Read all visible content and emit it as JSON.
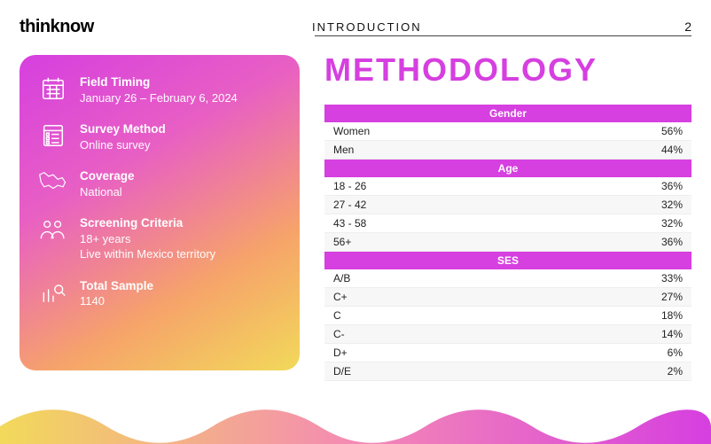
{
  "header": {
    "brand": "thinknow",
    "title": "INTRODUCTION",
    "page": "2"
  },
  "card": {
    "field_timing": {
      "title": "Field Timing",
      "sub": "January 26 – February 6, 2024"
    },
    "survey_method": {
      "title": "Survey Method",
      "sub": "Online survey"
    },
    "coverage": {
      "title": "Coverage",
      "sub": "National"
    },
    "screening": {
      "title": "Screening Criteria",
      "sub1": "18+ years",
      "sub2": "Live within Mexico territory"
    },
    "total_sample": {
      "title": "Total Sample",
      "sub": "1140"
    }
  },
  "main": {
    "title": "METHODOLOGY",
    "sections": {
      "gender": {
        "label": "Gender",
        "rows": [
          {
            "label": "Women",
            "value": "56%"
          },
          {
            "label": "Men",
            "value": "44%"
          }
        ]
      },
      "age": {
        "label": "Age",
        "rows": [
          {
            "label": "18 - 26",
            "value": "36%"
          },
          {
            "label": "27 - 42",
            "value": "32%"
          },
          {
            "label": "43 - 58",
            "value": "32%"
          },
          {
            "label": "56+",
            "value": "36%"
          }
        ]
      },
      "ses": {
        "label": "SES",
        "rows": [
          {
            "label": "A/B",
            "value": "33%"
          },
          {
            "label": "C+",
            "value": "27%"
          },
          {
            "label": "C",
            "value": "18%"
          },
          {
            "label": "C-",
            "value": "14%"
          },
          {
            "label": "D+",
            "value": "6%"
          },
          {
            "label": "D/E",
            "value": "2%"
          }
        ]
      }
    }
  }
}
